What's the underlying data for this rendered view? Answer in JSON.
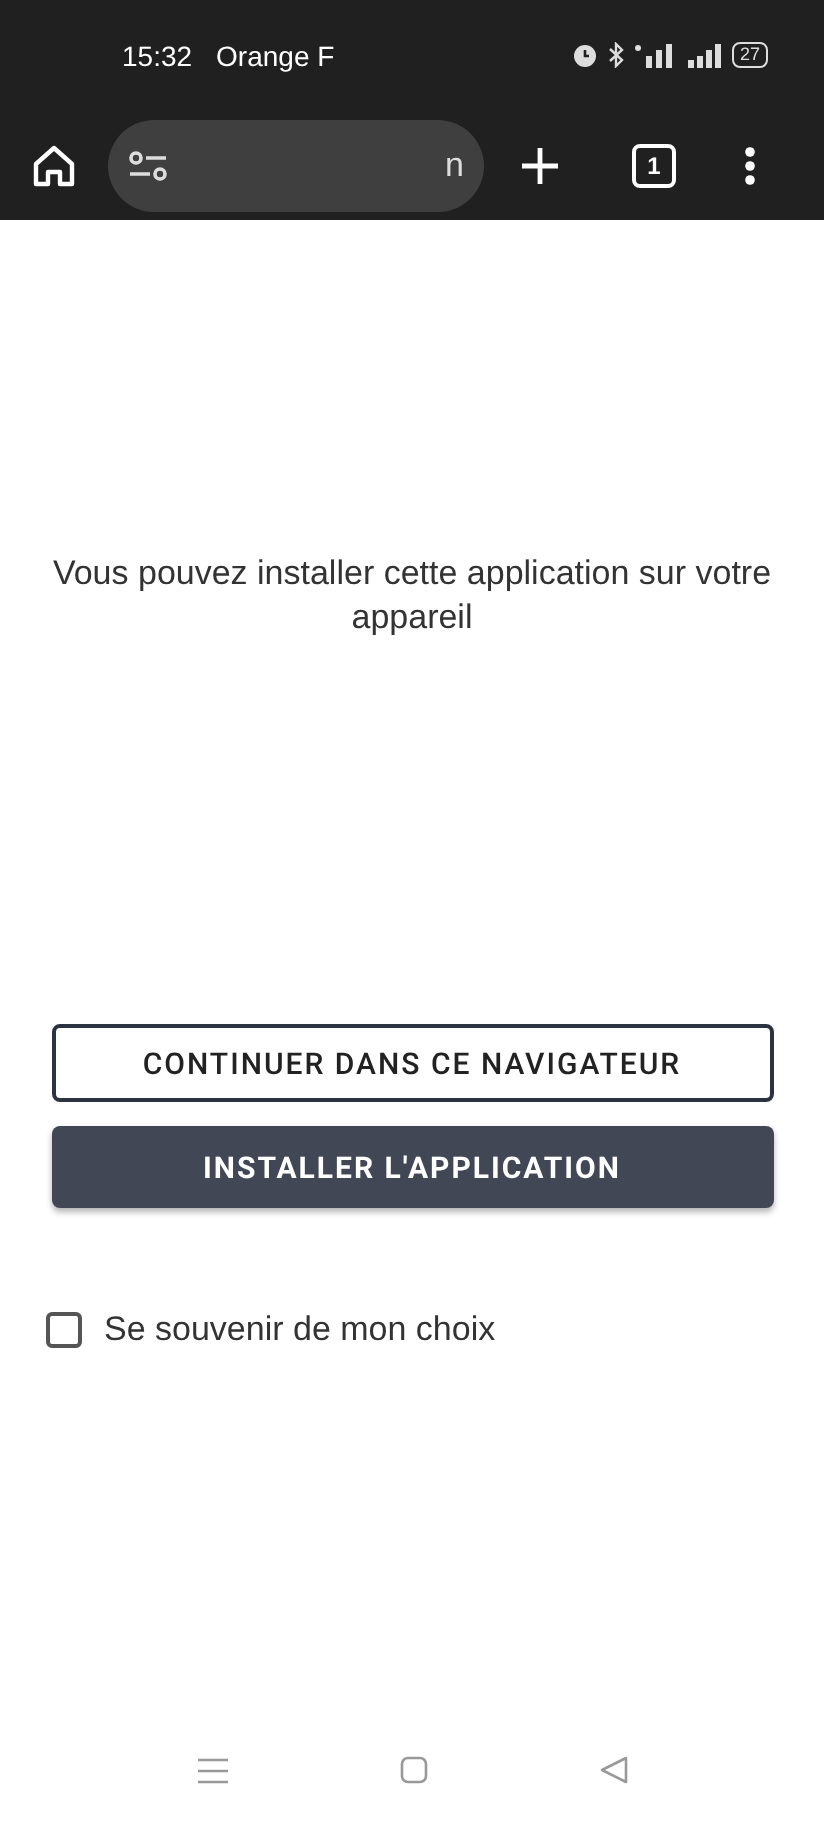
{
  "status_bar": {
    "time": "15:32",
    "carrier": "Orange F",
    "battery": "27"
  },
  "toolbar": {
    "address": "n",
    "tab_count": "1"
  },
  "message": "Vous pouvez installer cette application sur votre appareil",
  "buttons": [
    {
      "label": "CONTINUER DANS CE NAVIGATEUR",
      "kind": "outlined"
    },
    {
      "label": "INSTALLER L'APPLICATION",
      "kind": "filled"
    }
  ],
  "remember": {
    "label": "Se souvenir de mon choix",
    "checked": false
  }
}
